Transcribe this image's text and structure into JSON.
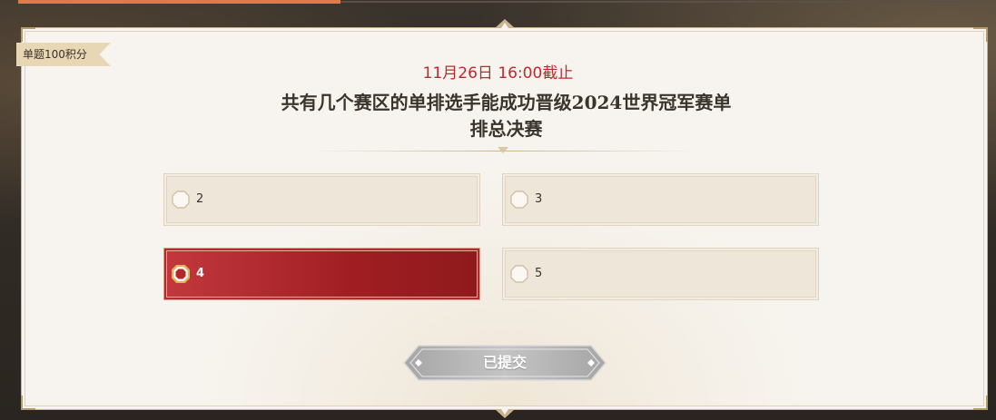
{
  "colors": {
    "deadline": "#c0282d",
    "selected_option": "#a01e22",
    "option_bg": "#efe6da",
    "panel_bg": "#f7f4ef",
    "submit_button": "#b9b9b9"
  },
  "quiz": {
    "score_tag": "单题100积分",
    "deadline": "11月26日 16:00截止",
    "question_line1": "共有几个赛区的单排选手能成功晋级2024世界冠军赛单",
    "question_line2": "排总决赛",
    "options": [
      {
        "label": "2",
        "selected": false
      },
      {
        "label": "3",
        "selected": false
      },
      {
        "label": "4",
        "selected": true
      },
      {
        "label": "5",
        "selected": false
      }
    ],
    "submit_label": "已提交",
    "submitted": true
  }
}
